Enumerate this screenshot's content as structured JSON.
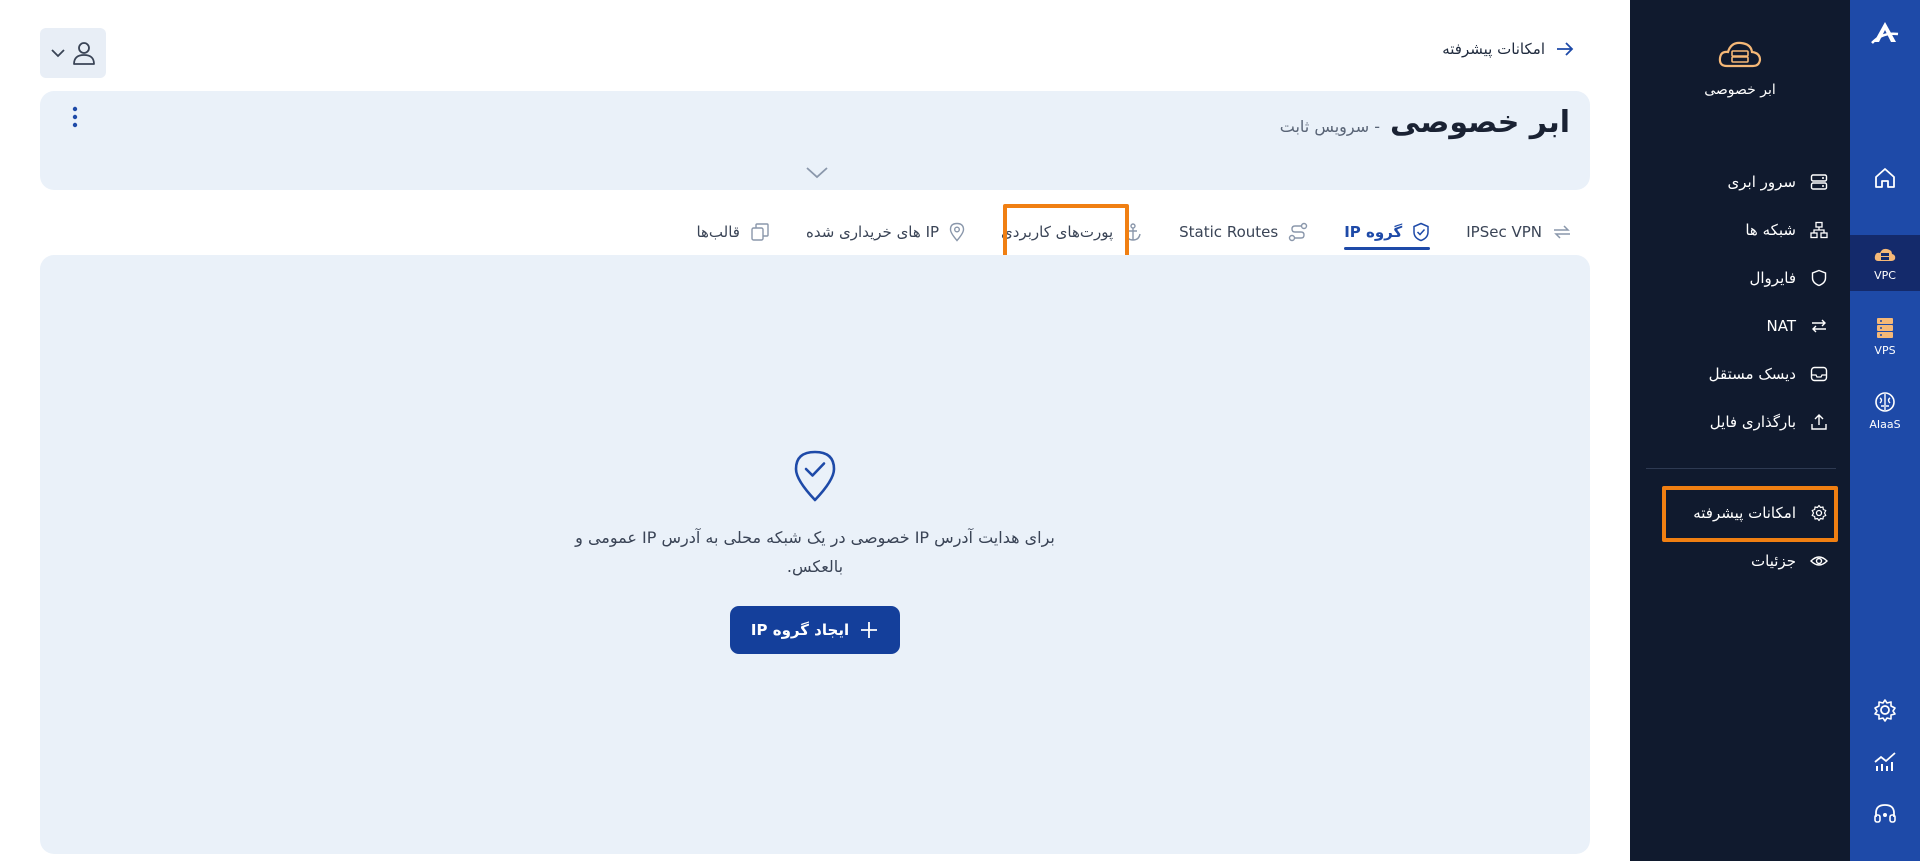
{
  "nav": {
    "back_label": "امکانات پیشرفته"
  },
  "rail": {
    "items": [
      {
        "label": "",
        "icon": "home-icon"
      },
      {
        "label": "VPC",
        "icon": "cloud-server-icon"
      },
      {
        "label": "VPS",
        "icon": "server-rack-icon"
      },
      {
        "label": "AIaaS",
        "icon": "brain-icon"
      }
    ],
    "bottom": [
      "gear-icon",
      "chart-icon",
      "support-headset-icon"
    ]
  },
  "sidebar": {
    "brand_label": "ابر خصوصی",
    "items": [
      {
        "label": "سرور ابری",
        "icon": "server-icon"
      },
      {
        "label": "شبکه ها",
        "icon": "network-icon"
      },
      {
        "label": "فایروال",
        "icon": "shield-icon"
      },
      {
        "label": "NAT",
        "icon": "arrows-exchange-icon"
      },
      {
        "label": "دیسک مستقل",
        "icon": "inbox-disk-icon"
      },
      {
        "label": "بارگذاری فایل",
        "icon": "upload-icon"
      },
      {
        "label": "امکانات پیشرفته",
        "icon": "gear-icon"
      },
      {
        "label": "جزئیات",
        "icon": "eye-icon"
      }
    ]
  },
  "header": {
    "title": "ابر خصوصی",
    "subtitle": "- سرویس ثابت"
  },
  "tabs": [
    {
      "label": "IPSec VPN",
      "icon": "swap-icon"
    },
    {
      "label": "گروه IP",
      "icon": "shield-check-icon",
      "active": true
    },
    {
      "label": "Static Routes",
      "icon": "route-icon"
    },
    {
      "label": "پورت‌های کاربردی",
      "icon": "anchor-icon"
    },
    {
      "label": "IP های خریداری شده",
      "icon": "location-pin-icon"
    },
    {
      "label": "قالب‌ها",
      "icon": "templates-icon"
    }
  ],
  "empty_state": {
    "text": "برای هدایت آدرس IP خصوصی در یک شبکه محلی به آدرس IP عمومی و بالعکس.",
    "button_label": "ایجاد گروه IP"
  },
  "colors": {
    "accent": "#1e4aa8",
    "highlight": "#f07f12",
    "sidebar_bg": "#101a2e",
    "panel_bg": "#eaf1f9"
  }
}
